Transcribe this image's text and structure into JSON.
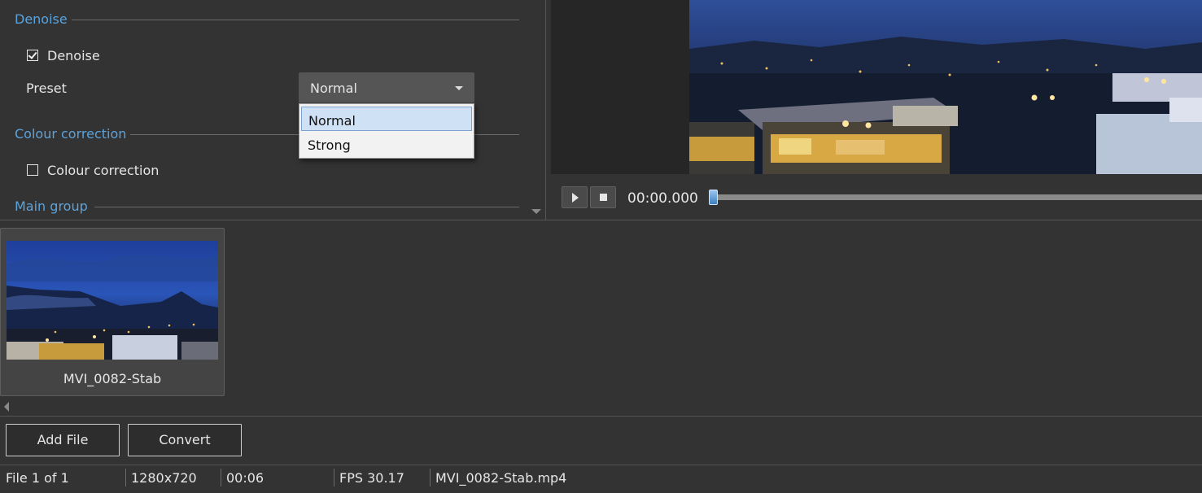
{
  "settings": {
    "denoise_group": {
      "title": "Denoise",
      "checkbox_label": "Denoise",
      "checked": true,
      "preset_label": "Preset",
      "preset_value": "Normal",
      "preset_options": [
        "Normal",
        "Strong"
      ],
      "highlighted_option": "Normal"
    },
    "colour_group": {
      "title": "Colour correction",
      "checkbox_label": "Colour correction",
      "checked": false
    },
    "main_group": {
      "title": "Main group"
    }
  },
  "player": {
    "timecode": "00:00.000",
    "play_icon": "play-icon",
    "stop_icon": "stop-icon"
  },
  "file_list": {
    "items": [
      {
        "name": "MVI_0082-Stab"
      }
    ]
  },
  "actions": {
    "add_file": "Add File",
    "convert": "Convert"
  },
  "status_bar": {
    "file_count": "File 1 of 1",
    "resolution": "1280x720",
    "duration": "00:06",
    "fps": "FPS 30.17",
    "filename": "MVI_0082-Stab.mp4"
  },
  "colors": {
    "background": "#333333",
    "group_title": "#5ba3dc",
    "dropdown_highlight": "#cfe1f5",
    "seek_thumb": "#3d7fc2"
  }
}
